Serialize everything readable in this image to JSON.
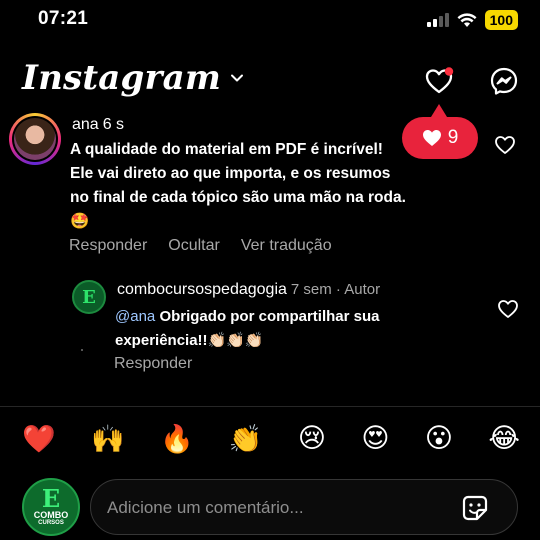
{
  "status_bar": {
    "time": "07:21",
    "battery": "100"
  },
  "header": {
    "title": "Instagram",
    "dropdown_icon": "chevron-down-icon",
    "activity_icon": "heart-icon",
    "messenger_icon": "messenger-icon"
  },
  "notification": {
    "like_count": "9"
  },
  "comment": {
    "username": "ana",
    "time": "6 s",
    "text": "A qualidade do material em PDF é incrível! Ele vai direto ao que importa, e os resumos no final de cada tópico são uma mão na roda.🤩",
    "actions": [
      "Responder",
      "Ocultar",
      "Ver tradução"
    ]
  },
  "reply": {
    "username": "combocursospedagogia",
    "meta": "7 sem · Autor",
    "mention": "@ana",
    "text": "Obrigado por compartilhar sua experiência!!👏🏻👏🏻👏🏻",
    "action": "Responder",
    "avatar_letter": "E"
  },
  "emoji_bar": [
    "❤️",
    "🙌",
    "🔥",
    "👏",
    "😢",
    "😍",
    "😮",
    "😂"
  ],
  "composer": {
    "placeholder": "Adicione um comentário...",
    "avatar_letter": "E",
    "avatar_line1": "COMBO",
    "avatar_line2": "CURSOS"
  },
  "colors": {
    "like_red": "#e8233c",
    "mention_blue": "#9ec7ff",
    "battery_yellow": "#f7d800"
  }
}
